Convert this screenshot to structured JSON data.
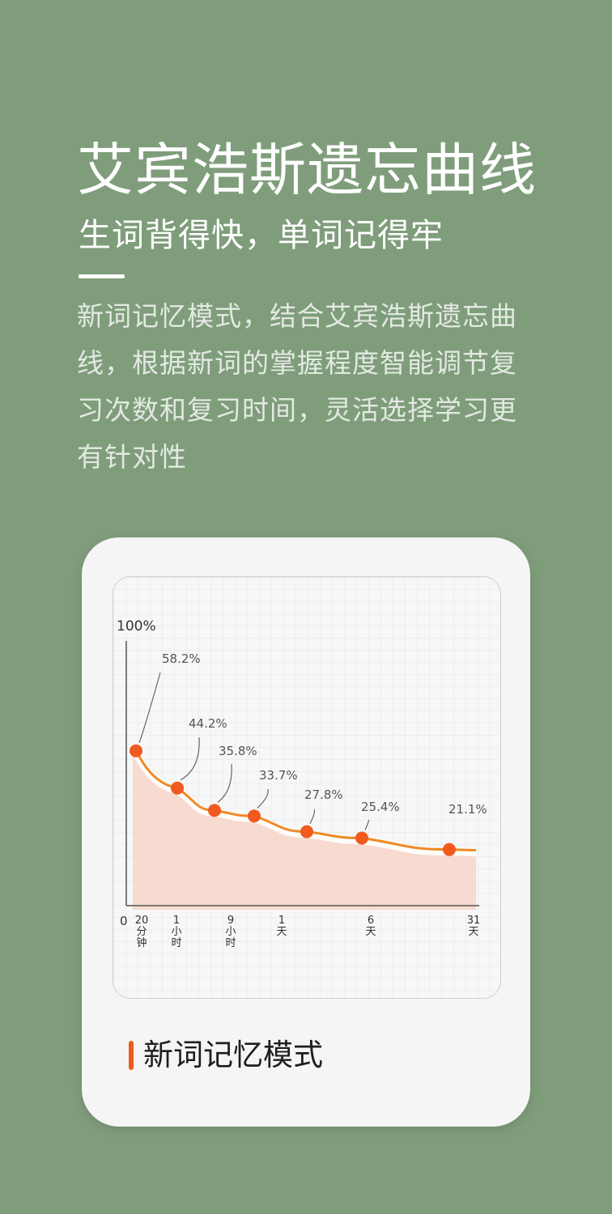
{
  "header": {
    "title": "艾宾浩斯遗忘曲线",
    "subtitle": "生词背得快，单词记得牢",
    "description": "新词记忆模式，结合艾宾浩斯遗忘曲线，根据新词的掌握程度智能调节复习次数和复习时间，灵活选择学习更有针对性"
  },
  "card": {
    "title": "新词记忆模式"
  },
  "colors": {
    "background": "#7f9d7b",
    "accent": "#f05a1e",
    "curve": "#f08a24",
    "fill": "#f7d5c9"
  },
  "chart_data": {
    "type": "line",
    "y_top_label": "100%",
    "origin_label": "0",
    "points": [
      {
        "x_label": [
          "20",
          "分",
          "钟"
        ],
        "value": 58.2,
        "label": "58.2%"
      },
      {
        "x_label": [
          "1",
          "小",
          "时"
        ],
        "value": 44.2,
        "label": "44.2%"
      },
      {
        "x_label": [
          "9",
          "小",
          "时"
        ],
        "value": 35.8,
        "label": "35.8%"
      },
      {
        "x_label": [
          "1",
          "天"
        ],
        "value": 33.7,
        "label": "33.7%"
      },
      {
        "x_label": [],
        "value": 27.8,
        "label": "27.8%"
      },
      {
        "x_label": [
          "6",
          "天"
        ],
        "value": 25.4,
        "label": "25.4%"
      },
      {
        "x_label": [
          "31",
          "天"
        ],
        "value": 21.1,
        "label": "21.1%"
      }
    ]
  }
}
